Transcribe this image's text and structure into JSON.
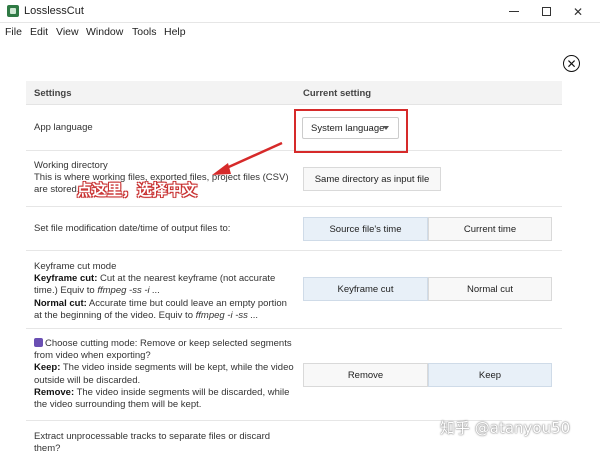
{
  "window": {
    "title": "LosslessCut"
  },
  "menu": [
    "File",
    "Edit",
    "View",
    "Window",
    "Tools",
    "Help"
  ],
  "header": {
    "col1": "Settings",
    "col2": "Current setting"
  },
  "rows": {
    "app_language": {
      "label": "App language",
      "select_value": "System language"
    },
    "working_directory": {
      "title": "Working directory",
      "line1": "This is where working files, exported files, project files (CSV)",
      "line2": "are stored.",
      "button": "Same directory as input file"
    },
    "file_mod_date": {
      "label": "Set file modification date/time of output files to:",
      "option1": "Source file's time",
      "option2": "Current time"
    },
    "keyframe_cut": {
      "title": "Keyframe cut mode",
      "kf_label": "Keyframe cut:",
      "kf_text1": " Cut at the nearest keyframe (not accurate",
      "kf_text2a": "time.) Equiv to ",
      "kf_code": "ffmpeg -ss -i ...",
      "normal_label": "Normal cut:",
      "normal_text1": " Accurate time but could leave an empty portion",
      "normal_text2a": "at the beginning of the video. Equiv to ",
      "normal_code": "ffmpeg -i -ss ...",
      "option1": "Keyframe cut",
      "option2": "Normal cut"
    },
    "cutting_mode": {
      "title1": "Choose cutting mode: Remove or keep selected segments",
      "title2": "from video when exporting?",
      "keep_label": "Keep:",
      "keep_text1": " The video inside segments will be kept, while the video",
      "keep_text2": "outside will be discarded.",
      "remove_label": "Remove:",
      "remove_text1": " The video inside segments will be discarded, while",
      "remove_text2": "the video surrounding them will be kept.",
      "option1": "Remove",
      "option2": "Keep"
    },
    "extract_tracks": {
      "line1": "Extract unprocessable tracks to separate files or discard",
      "line2": "them?"
    }
  },
  "annotation": {
    "text": "点这里，选择中文"
  },
  "watermark": {
    "text": "知乎 @atanyou50"
  },
  "colors": {
    "highlight": "#d62a2a",
    "active_button": "#e8f0f8"
  },
  "icons": [
    "app-icon",
    "close-circle-icon",
    "caret-down-icon",
    "cutting-mode-icon"
  ]
}
